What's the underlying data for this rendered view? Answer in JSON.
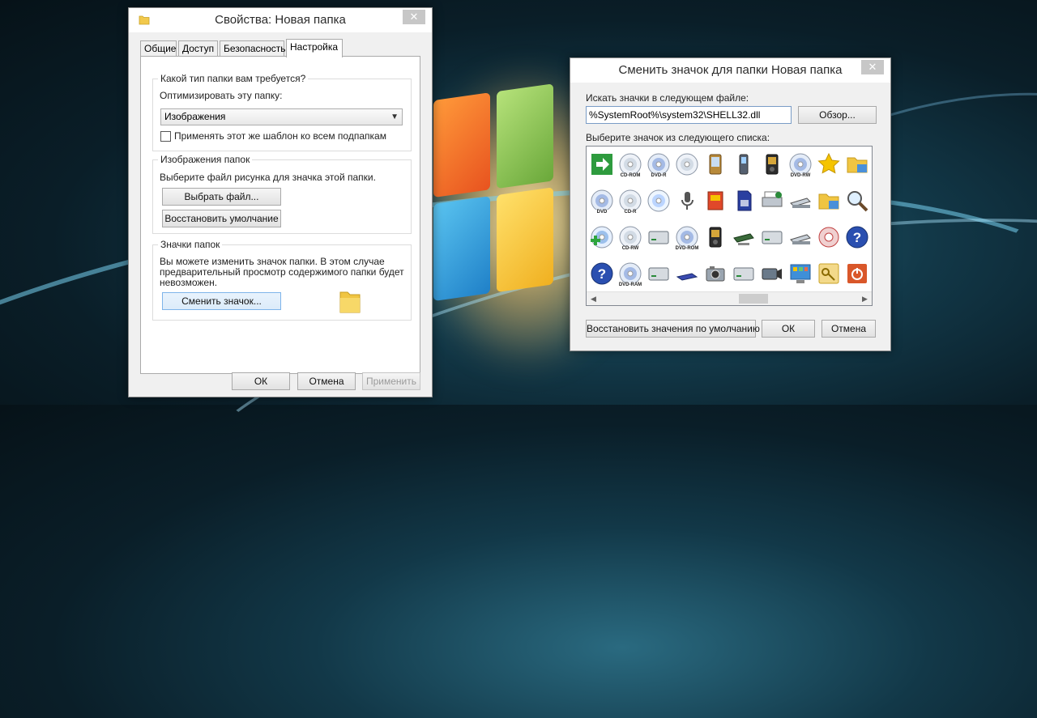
{
  "properties_dialog": {
    "title": "Свойства: Новая папка",
    "tabs": [
      "Общие",
      "Доступ",
      "Безопасность",
      "Настройка"
    ],
    "active_tab": "Настройка",
    "folder_type_group": {
      "title": "Какой тип папки вам требуется?",
      "optimize_label": "Оптимизировать эту папку:",
      "optimize_value": "Изображения",
      "apply_subfolders_label": "Применять этот же шаблон ко всем подпапкам",
      "apply_subfolders_checked": false
    },
    "folder_pictures_group": {
      "title": "Изображения папок",
      "description": "Выберите файл рисунка для значка этой папки.",
      "choose_file_button": "Выбрать файл...",
      "restore_default_button": "Восстановить умолчание"
    },
    "folder_icons_group": {
      "title": "Значки папок",
      "description_line1": "Вы можете изменить значок папки. В этом случае",
      "description_line2": "предварительный просмотр содержимого папки будет",
      "description_line3": "невозможен.",
      "change_icon_button": "Сменить значок..."
    },
    "buttons": {
      "ok": "ОК",
      "cancel": "Отмена",
      "apply": "Применить"
    }
  },
  "change_icon_dialog": {
    "title": "Сменить значок для папки Новая папка",
    "file_label": "Искать значки в следующем файле:",
    "file_path": "%SystemRoot%\\system32\\SHELL32.dll",
    "browse_button": "Обзор...",
    "list_label": "Выберите значок из следующего списка:",
    "icon_rows": [
      [
        {
          "name": "green-arrow-icon",
          "label": ""
        },
        {
          "name": "cd-rom-icon",
          "label": "CD-ROM"
        },
        {
          "name": "dvd-r-icon",
          "label": "DVD-R"
        },
        {
          "name": "cd-disc-icon",
          "label": ""
        },
        {
          "name": "pda-icon",
          "label": ""
        },
        {
          "name": "mobile-phone-icon",
          "label": ""
        },
        {
          "name": "media-player-icon",
          "label": ""
        },
        {
          "name": "dvd-rw-icon",
          "label": "DVD-RW"
        },
        {
          "name": "star-icon",
          "label": ""
        },
        {
          "name": "folder-calendar-icon",
          "label": ""
        }
      ],
      [
        {
          "name": "dvd-drive-icon",
          "label": "DVD"
        },
        {
          "name": "cd-r-icon",
          "label": "CD-R"
        },
        {
          "name": "audio-disc-icon",
          "label": ""
        },
        {
          "name": "microphone-icon",
          "label": ""
        },
        {
          "name": "memory-card-icon",
          "label": ""
        },
        {
          "name": "sd-card-icon",
          "label": ""
        },
        {
          "name": "network-printer-icon",
          "label": ""
        },
        {
          "name": "scanner-icon",
          "label": ""
        },
        {
          "name": "folder-icon",
          "label": ""
        },
        {
          "name": "magnifier-icon",
          "label": ""
        },
        {
          "name": "network-computer-icon",
          "label": ""
        }
      ],
      [
        {
          "name": "music-disc-add-icon",
          "label": ""
        },
        {
          "name": "cd-rw-icon",
          "label": "CD-RW"
        },
        {
          "name": "drive-icon",
          "label": ""
        },
        {
          "name": "dvd-rom-icon",
          "label": "DVD-ROM"
        },
        {
          "name": "mp3-player-icon",
          "label": ""
        },
        {
          "name": "network-drive-icon",
          "label": ""
        },
        {
          "name": "removable-drive-icon",
          "label": ""
        },
        {
          "name": "scanner-camera-icon",
          "label": ""
        },
        {
          "name": "settings-disc-icon",
          "label": ""
        },
        {
          "name": "help-icon",
          "label": ""
        },
        {
          "name": "eject-icon",
          "label": ""
        }
      ],
      [
        {
          "name": "unknown-disc-icon",
          "label": ""
        },
        {
          "name": "dvd-ram-icon",
          "label": "DVD-RAM"
        },
        {
          "name": "hard-drive-icon",
          "label": ""
        },
        {
          "name": "flat-drive-icon",
          "label": ""
        },
        {
          "name": "camera-icon",
          "label": ""
        },
        {
          "name": "external-drive-icon",
          "label": ""
        },
        {
          "name": "camcorder-icon",
          "label": ""
        },
        {
          "name": "control-panel-icon",
          "label": ""
        },
        {
          "name": "key-icon",
          "label": ""
        },
        {
          "name": "power-icon",
          "label": ""
        }
      ]
    ],
    "buttons": {
      "restore_defaults": "Восстановить значения по умолчанию",
      "ok": "ОК",
      "cancel": "Отмена"
    }
  }
}
